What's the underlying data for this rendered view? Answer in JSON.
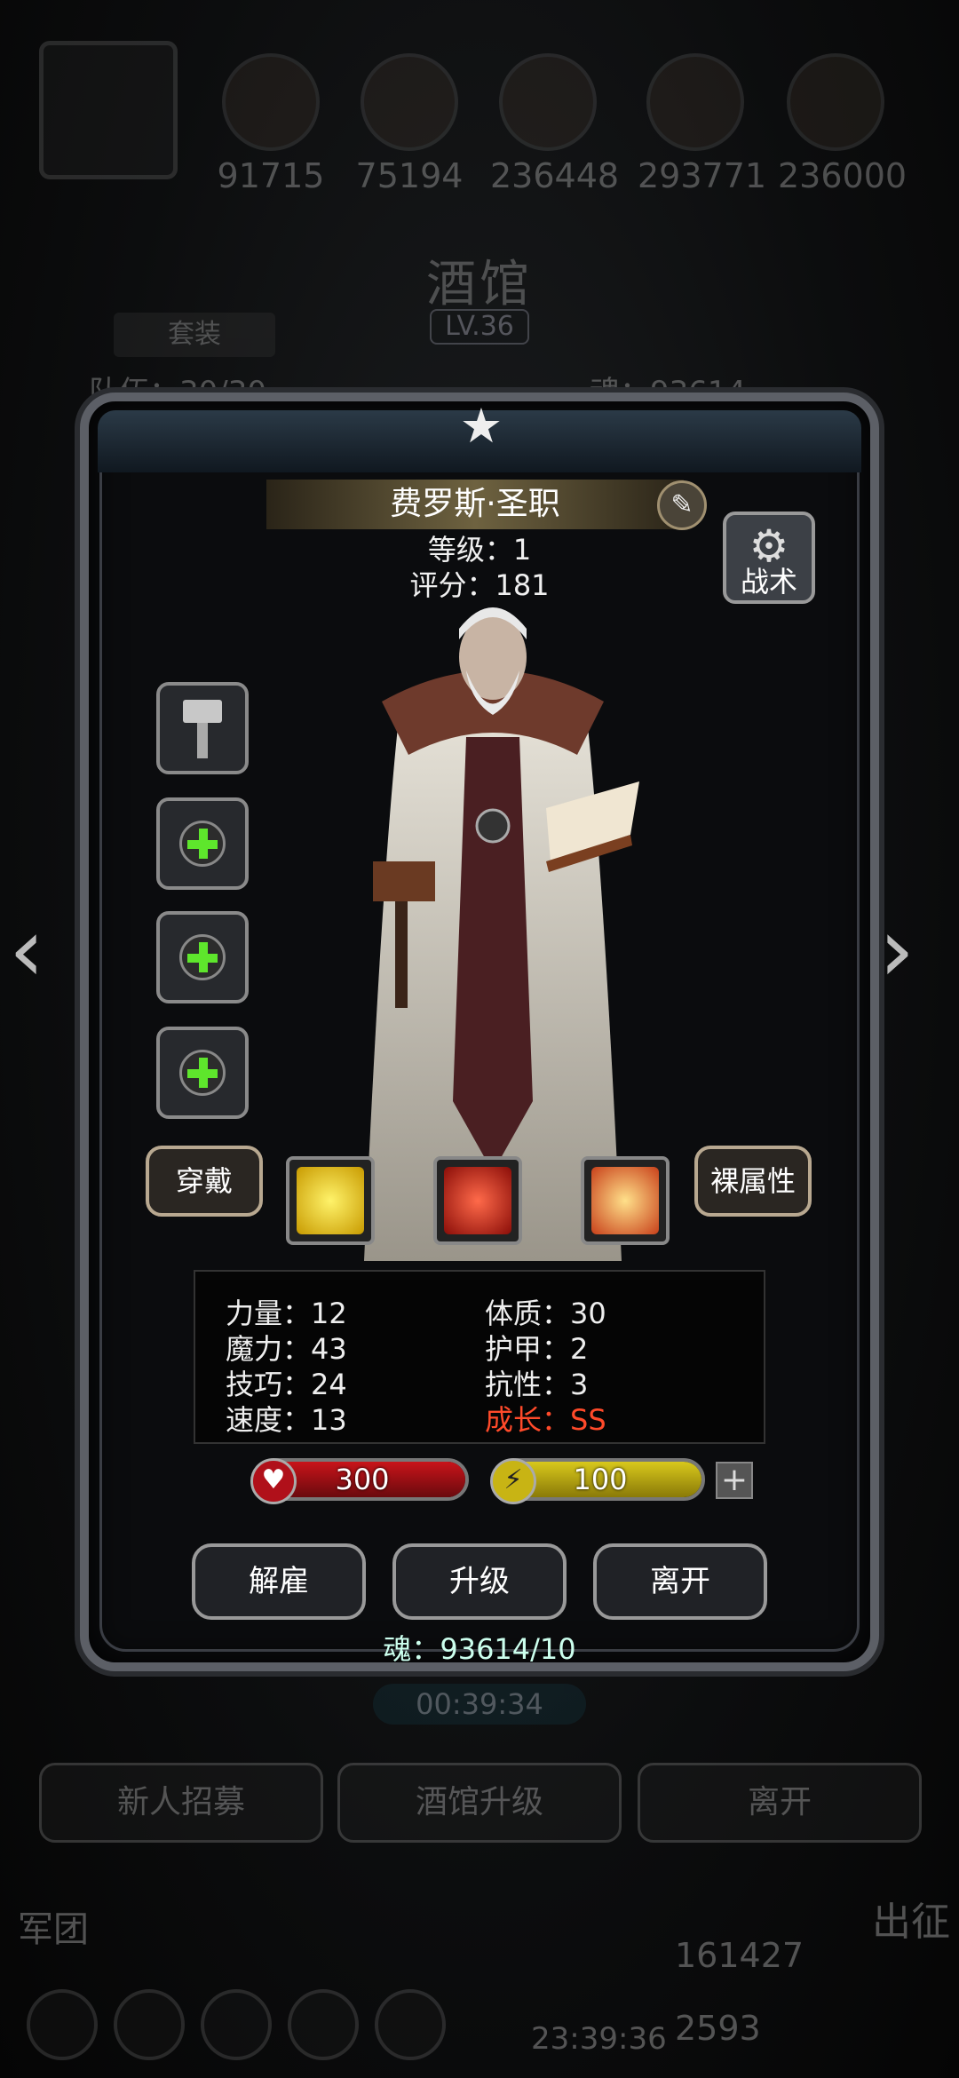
{
  "background": {
    "resources": [
      "91715",
      "75194",
      "236448",
      "293771",
      "236000"
    ],
    "title": "酒馆",
    "level": "LV.36",
    "tab_label": "套装",
    "left_stat": "队伍：30/30",
    "right_stat": "魂：93614",
    "timer": "00:39:34",
    "bottom_buttons": [
      "新人招募",
      "酒馆升级",
      "离开"
    ],
    "left_label": "军团",
    "right_label": "出征",
    "coins": "161427",
    "coins2": "2593",
    "clock": "23:39:36"
  },
  "hero": {
    "name": "费罗斯·圣职",
    "level_text": "等级：1",
    "score_text": "评分：181",
    "tactic_label": "战术"
  },
  "slots": [
    {
      "name": "weapon-slot",
      "icon": "hammer-icon"
    },
    {
      "name": "armor-slot",
      "icon": "plus-icon"
    },
    {
      "name": "accessory-slot-1",
      "icon": "plus-icon"
    },
    {
      "name": "accessory-slot-2",
      "icon": "plus-icon"
    }
  ],
  "buttons": {
    "equip": "穿戴",
    "bare_attributes": "裸属性",
    "dismiss": "解雇",
    "upgrade": "升级",
    "leave": "离开"
  },
  "skills": [
    "fist-icon",
    "cross-heal-icon",
    "holy-wings-icon"
  ],
  "stats": {
    "strength": "力量：12",
    "magic": "魔力：43",
    "skill": "技巧：24",
    "speed": "速度：13",
    "constitution": "体质：30",
    "armor": "护甲：2",
    "resistance": "抗性：3",
    "growth": "成长：SS"
  },
  "hp": {
    "value": "300",
    "fill": 1.0,
    "color": "#c8141a"
  },
  "energy": {
    "value": "100",
    "fill": 1.0,
    "color": "#d8c81c"
  },
  "soul_text": "魂：93614/10"
}
